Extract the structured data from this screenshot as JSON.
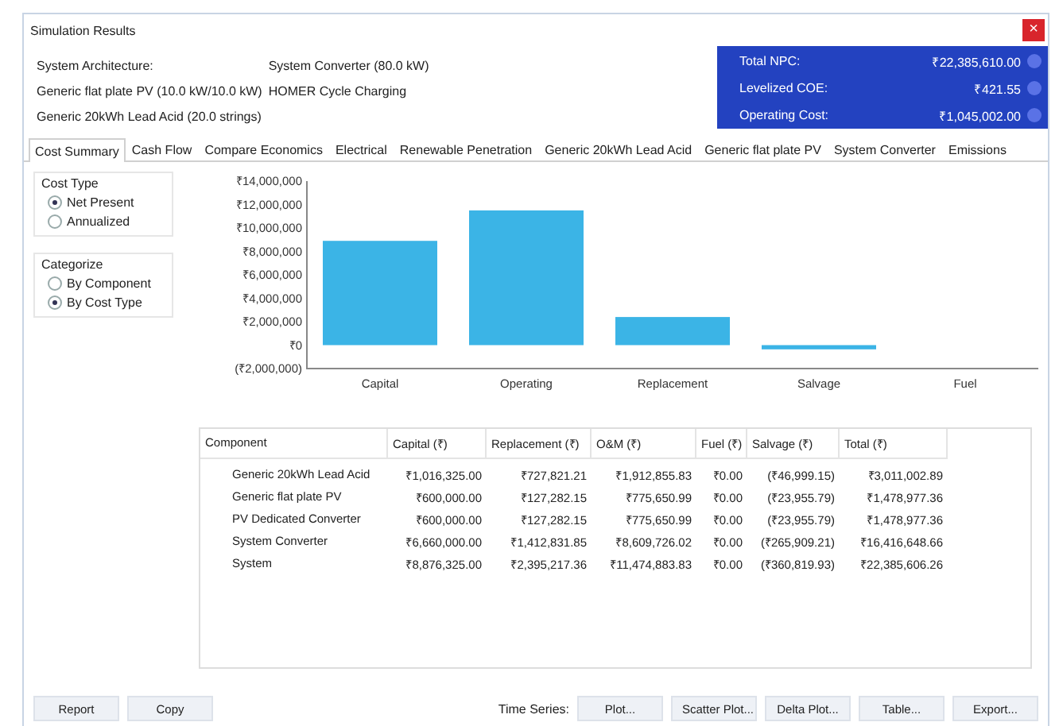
{
  "window": {
    "title": "Simulation Results",
    "close": "×"
  },
  "architecture": {
    "label": "System Architecture:",
    "items": [
      "Generic flat plate PV (10.0 kW/10.0 kW)",
      "Generic 20kWh Lead Acid (20.0 strings)"
    ],
    "items_2": [
      "System Converter (80.0 kW)",
      "HOMER Cycle Charging"
    ]
  },
  "summary": [
    {
      "label": "Total NPC:",
      "value": "₹22,385,610.00"
    },
    {
      "label": "Levelized COE:",
      "value": "₹421.55"
    },
    {
      "label": "Operating Cost:",
      "value": "₹1,045,002.00"
    }
  ],
  "tabs": [
    {
      "label": "Cost Summary",
      "selected": true
    },
    {
      "label": "Cash Flow",
      "selected": false
    },
    {
      "label": "Compare Economics",
      "selected": false
    },
    {
      "label": "Electrical",
      "selected": false
    },
    {
      "label": "Renewable Penetration",
      "selected": false
    },
    {
      "label": "Generic 20kWh Lead Acid",
      "selected": false
    },
    {
      "label": "Generic flat plate PV",
      "selected": false
    },
    {
      "label": "System Converter",
      "selected": false
    },
    {
      "label": "Emissions",
      "selected": false
    }
  ],
  "groups": [
    {
      "title": "Cost Type",
      "options": [
        {
          "label": "Net Present",
          "selected": true
        },
        {
          "label": "Annualized",
          "selected": false
        }
      ]
    },
    {
      "title": "Categorize",
      "options": [
        {
          "label": "By Component",
          "selected": false
        },
        {
          "label": "By Cost Type",
          "selected": true
        }
      ]
    }
  ],
  "chart_data": {
    "type": "bar",
    "categories": [
      "Capital",
      "Operating",
      "Replacement",
      "Salvage",
      "Fuel"
    ],
    "series": [
      {
        "color": "#3bb4e6",
        "values": [
          8900000,
          11500000,
          2400000,
          -360000,
          0
        ]
      }
    ],
    "ylim": [
      -2000000,
      14000000
    ],
    "yticks": [
      {
        "value": -2000000,
        "label": "(₹2,000,000)"
      },
      {
        "value": 0,
        "label": "₹0"
      },
      {
        "value": 2000000,
        "label": "₹2,000,000"
      },
      {
        "value": 4000000,
        "label": "₹4,000,000"
      },
      {
        "value": 6000000,
        "label": "₹6,000,000"
      },
      {
        "value": 8000000,
        "label": "₹8,000,000"
      },
      {
        "value": 10000000,
        "label": "₹10,000,000"
      },
      {
        "value": 12000000,
        "label": "₹12,000,000"
      },
      {
        "value": 14000000,
        "label": "₹14,000,000"
      }
    ]
  },
  "table": {
    "columns": [
      "Component",
      "Capital (₹)",
      "Replacement (₹)",
      "O&M (₹)",
      "Fuel (₹)",
      "Salvage (₹)",
      "Total (₹)"
    ],
    "rows": [
      [
        "Generic 20kWh Lead Acid",
        "₹1,016,325.00",
        "₹727,821.21",
        "₹1,912,855.83",
        "₹0.00",
        "(₹46,999.15)",
        "₹3,011,002.89"
      ],
      [
        "Generic flat plate PV",
        "₹600,000.00",
        "₹127,282.15",
        "₹775,650.99",
        "₹0.00",
        "(₹23,955.79)",
        "₹1,478,977.36"
      ],
      [
        "PV Dedicated Converter",
        "₹600,000.00",
        "₹127,282.15",
        "₹775,650.99",
        "₹0.00",
        "(₹23,955.79)",
        "₹1,478,977.36"
      ],
      [
        "System Converter",
        "₹6,660,000.00",
        "₹1,412,831.85",
        "₹8,609,726.02",
        "₹0.00",
        "(₹265,909.21)",
        "₹16,416,648.66"
      ],
      [
        "System",
        "₹8,876,325.00",
        "₹2,395,217.36",
        "₹11,474,883.83",
        "₹0.00",
        "(₹360,819.93)",
        "₹22,385,606.26"
      ]
    ]
  },
  "buttons_left": [
    "Report",
    "Copy"
  ],
  "time_series": {
    "label": "Time Series:",
    "buttons": [
      "Plot...",
      "Scatter Plot...",
      "Delta Plot...",
      "Table...",
      "Export..."
    ]
  }
}
